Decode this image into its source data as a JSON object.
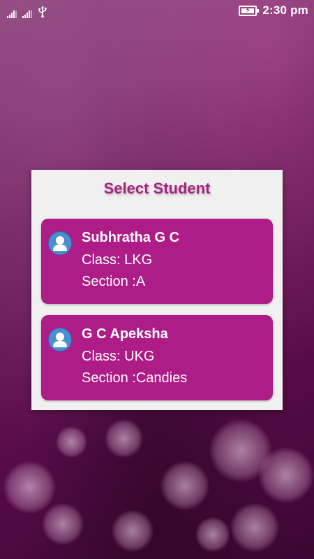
{
  "status_bar": {
    "time": "2:30 pm",
    "icons": [
      "signal-icon",
      "signal-icon",
      "usb-icon",
      "battery-charging-icon"
    ]
  },
  "dialog": {
    "title": "Select Student",
    "students": [
      {
        "name": "Subhratha G C",
        "class": "Class: LKG",
        "section": "Section :A",
        "icon": "user-avatar-icon"
      },
      {
        "name": "G C Apeksha",
        "class": "Class: UKG",
        "section": "Section :Candies",
        "icon": "user-avatar-icon"
      }
    ]
  },
  "colors": {
    "accent": "#ad1c87",
    "title": "#a8237f",
    "dialog_bg": "#f0f0f0",
    "avatar_bg": "#4a8fd0"
  }
}
